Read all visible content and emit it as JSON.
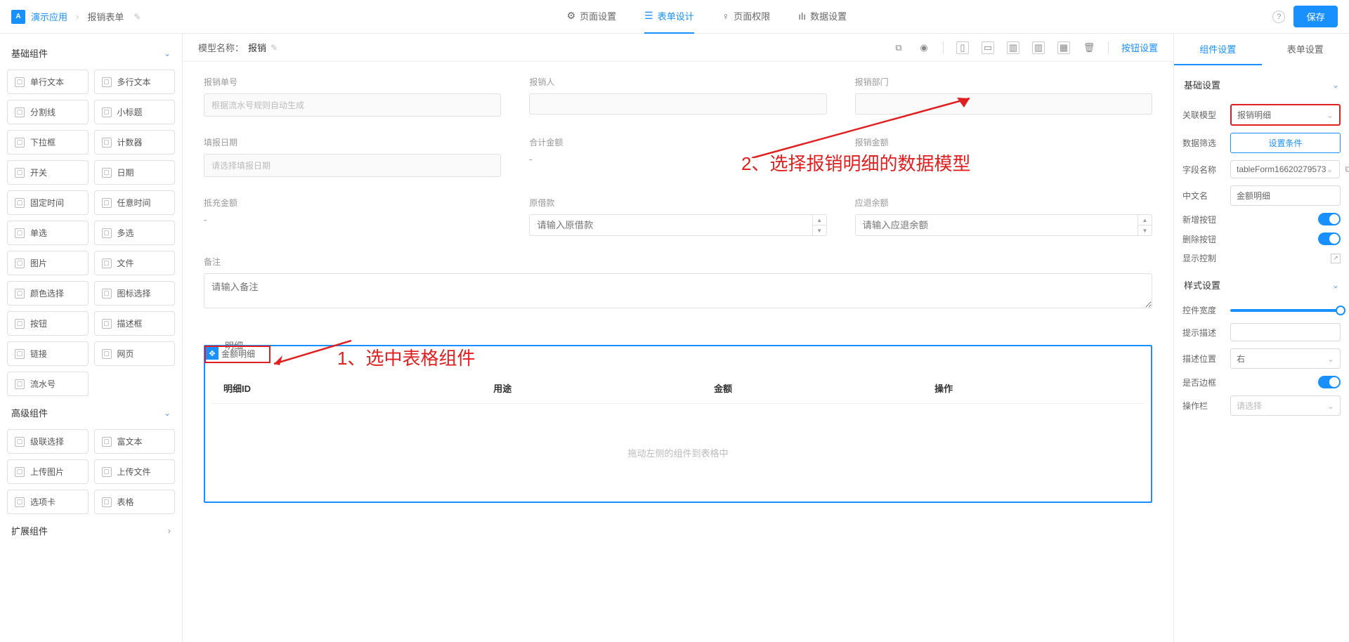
{
  "header": {
    "breadcrumb_app": "演示应用",
    "breadcrumb_page": "报销表单",
    "nav": [
      {
        "label": "页面设置",
        "icon": "⚙"
      },
      {
        "label": "表单设计",
        "icon": "☰"
      },
      {
        "label": "页面权限",
        "icon": "👤"
      },
      {
        "label": "数据设置",
        "icon": "📊"
      }
    ],
    "save": "保存"
  },
  "left": {
    "groups": [
      {
        "title": "基础组件"
      },
      {
        "title": "高级组件"
      },
      {
        "title": "扩展组件"
      }
    ],
    "basic": [
      "单行文本",
      "多行文本",
      "分割线",
      "小标题",
      "下拉框",
      "计数器",
      "开关",
      "日期",
      "固定时间",
      "任意时间",
      "单选",
      "多选",
      "图片",
      "文件",
      "颜色选择",
      "图标选择",
      "按钮",
      "描述框",
      "链接",
      "网页",
      "流水号"
    ],
    "advanced": [
      "级联选择",
      "富文本",
      "上传图片",
      "上传文件",
      "选项卡",
      "表格"
    ]
  },
  "canvas": {
    "model_label": "模型名称：",
    "model_name": "报销",
    "btn_config": "按钮设置",
    "fields": {
      "r1c1_label": "报销单号",
      "r1c1_ph": "根据流水号规则自动生成",
      "r1c2_label": "报销人",
      "r1c3_label": "报销部门",
      "r2c1_label": "填报日期",
      "r2c1_ph": "请选择填报日期",
      "r2c2_label": "合计金额",
      "r2c2_val": "-",
      "r2c3_label": "报销金额",
      "r2c3_val": "-",
      "r3c1_label": "抵充金额",
      "r3c1_val": "-",
      "r3c2_label": "原借款",
      "r3c2_ph": "请输入原借款",
      "r3c3_label": "应退余额",
      "r3c3_ph": "请输入应退余额",
      "r4_label": "备注",
      "r4_ph": "请输入备注"
    },
    "detail": {
      "legend": "明细",
      "tag": "金额明细",
      "cols": [
        "明细ID",
        "用途",
        "金额",
        "操作"
      ],
      "empty": "拖动左侧的组件到表格中"
    }
  },
  "right": {
    "tabs": [
      "组件设置",
      "表单设置"
    ],
    "section1": "基础设置",
    "model_label": "关联模型",
    "model_val": "报销明细",
    "filter_label": "数据筛选",
    "filter_btn": "设置条件",
    "field_label": "字段名称",
    "field_val": "tableForm16620279573",
    "cn_label": "中文名",
    "cn_val": "金额明细",
    "add_btn": "新增按钮",
    "del_btn": "删除按钮",
    "show_ctrl": "显示控制",
    "section2": "样式设置",
    "width_label": "控件宽度",
    "hint_label": "提示描述",
    "pos_label": "描述位置",
    "pos_val": "右",
    "border_label": "是否边框",
    "op_label": "操作栏",
    "op_ph": "请选择"
  },
  "annotations": {
    "a1": "1、选中表格组件",
    "a2": "2、选择报销明细的数据模型"
  }
}
